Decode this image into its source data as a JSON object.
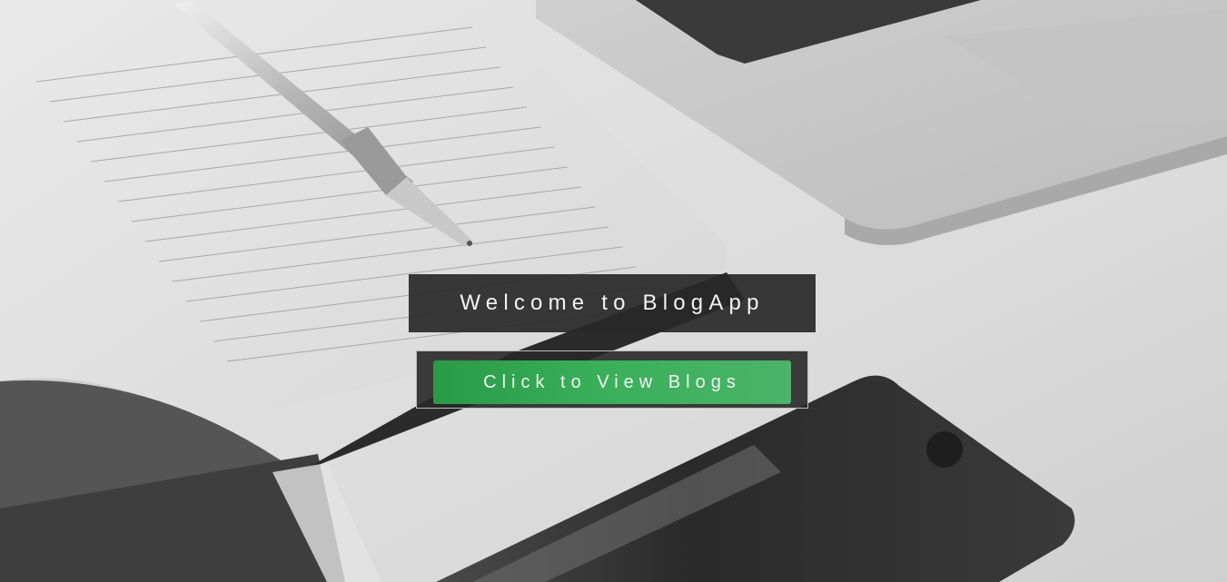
{
  "hero": {
    "title": "Welcome to BlogApp",
    "cta_label": "Click to View Blogs"
  },
  "colors": {
    "overlay": "#282828",
    "button_green": "#3bb05a",
    "text": "#f2f2f2"
  },
  "background": {
    "description_icon": "desk-photo",
    "objects": [
      "notebook",
      "pen",
      "laptop",
      "smartphone"
    ]
  }
}
